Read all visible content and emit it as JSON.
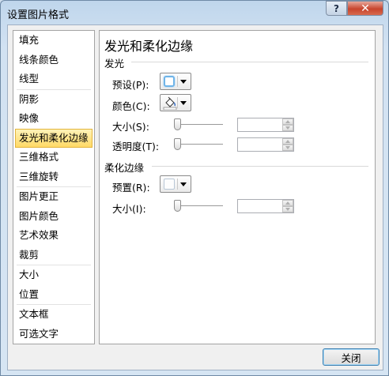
{
  "window": {
    "title": "设置图片格式",
    "help_glyph": "?",
    "close_glyph": "✕"
  },
  "nav": {
    "groups": [
      [
        "填充",
        "线条颜色",
        "线型"
      ],
      [
        "阴影",
        "映像",
        "发光和柔化边缘",
        "三维格式",
        "三维旋转"
      ],
      [
        "图片更正",
        "图片颜色",
        "艺术效果",
        "裁剪"
      ],
      [
        "大小",
        "位置"
      ],
      [
        "文本框",
        "可选文字"
      ]
    ],
    "selected": "发光和柔化边缘"
  },
  "panel": {
    "title": "发光和柔化边缘",
    "glow": {
      "section": "发光",
      "preset_label": "预设(P):",
      "color_label": "颜色(C):",
      "size_label": "大小(S):",
      "size_value": "",
      "transparency_label": "透明度(T):",
      "transparency_value": ""
    },
    "soft_edges": {
      "section": "柔化边缘",
      "preset_label": "预置(R):",
      "size_label": "大小(I):",
      "size_value": ""
    }
  },
  "footer": {
    "close_label": "关闭"
  },
  "colors": {
    "selected_bg": "#ffd966",
    "glow_swatch": "#6fb4e8",
    "close_button": "#c7442d"
  }
}
